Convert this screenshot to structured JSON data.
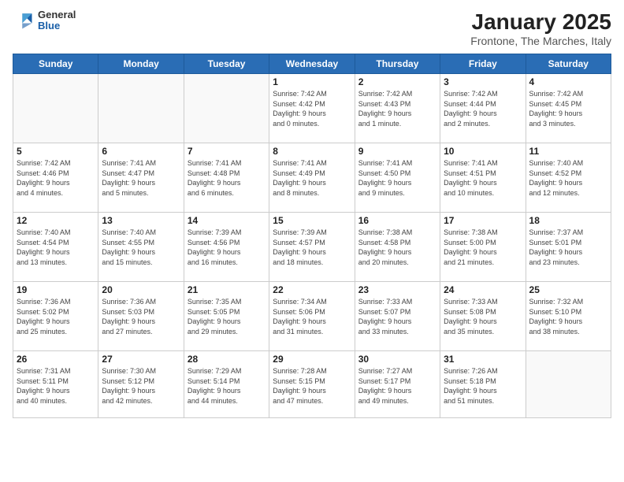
{
  "logo": {
    "line1": "General",
    "line2": "Blue"
  },
  "title": "January 2025",
  "subtitle": "Frontone, The Marches, Italy",
  "headers": [
    "Sunday",
    "Monday",
    "Tuesday",
    "Wednesday",
    "Thursday",
    "Friday",
    "Saturday"
  ],
  "weeks": [
    [
      {
        "num": "",
        "info": ""
      },
      {
        "num": "",
        "info": ""
      },
      {
        "num": "",
        "info": ""
      },
      {
        "num": "1",
        "info": "Sunrise: 7:42 AM\nSunset: 4:42 PM\nDaylight: 9 hours\nand 0 minutes."
      },
      {
        "num": "2",
        "info": "Sunrise: 7:42 AM\nSunset: 4:43 PM\nDaylight: 9 hours\nand 1 minute."
      },
      {
        "num": "3",
        "info": "Sunrise: 7:42 AM\nSunset: 4:44 PM\nDaylight: 9 hours\nand 2 minutes."
      },
      {
        "num": "4",
        "info": "Sunrise: 7:42 AM\nSunset: 4:45 PM\nDaylight: 9 hours\nand 3 minutes."
      }
    ],
    [
      {
        "num": "5",
        "info": "Sunrise: 7:42 AM\nSunset: 4:46 PM\nDaylight: 9 hours\nand 4 minutes."
      },
      {
        "num": "6",
        "info": "Sunrise: 7:41 AM\nSunset: 4:47 PM\nDaylight: 9 hours\nand 5 minutes."
      },
      {
        "num": "7",
        "info": "Sunrise: 7:41 AM\nSunset: 4:48 PM\nDaylight: 9 hours\nand 6 minutes."
      },
      {
        "num": "8",
        "info": "Sunrise: 7:41 AM\nSunset: 4:49 PM\nDaylight: 9 hours\nand 8 minutes."
      },
      {
        "num": "9",
        "info": "Sunrise: 7:41 AM\nSunset: 4:50 PM\nDaylight: 9 hours\nand 9 minutes."
      },
      {
        "num": "10",
        "info": "Sunrise: 7:41 AM\nSunset: 4:51 PM\nDaylight: 9 hours\nand 10 minutes."
      },
      {
        "num": "11",
        "info": "Sunrise: 7:40 AM\nSunset: 4:52 PM\nDaylight: 9 hours\nand 12 minutes."
      }
    ],
    [
      {
        "num": "12",
        "info": "Sunrise: 7:40 AM\nSunset: 4:54 PM\nDaylight: 9 hours\nand 13 minutes."
      },
      {
        "num": "13",
        "info": "Sunrise: 7:40 AM\nSunset: 4:55 PM\nDaylight: 9 hours\nand 15 minutes."
      },
      {
        "num": "14",
        "info": "Sunrise: 7:39 AM\nSunset: 4:56 PM\nDaylight: 9 hours\nand 16 minutes."
      },
      {
        "num": "15",
        "info": "Sunrise: 7:39 AM\nSunset: 4:57 PM\nDaylight: 9 hours\nand 18 minutes."
      },
      {
        "num": "16",
        "info": "Sunrise: 7:38 AM\nSunset: 4:58 PM\nDaylight: 9 hours\nand 20 minutes."
      },
      {
        "num": "17",
        "info": "Sunrise: 7:38 AM\nSunset: 5:00 PM\nDaylight: 9 hours\nand 21 minutes."
      },
      {
        "num": "18",
        "info": "Sunrise: 7:37 AM\nSunset: 5:01 PM\nDaylight: 9 hours\nand 23 minutes."
      }
    ],
    [
      {
        "num": "19",
        "info": "Sunrise: 7:36 AM\nSunset: 5:02 PM\nDaylight: 9 hours\nand 25 minutes."
      },
      {
        "num": "20",
        "info": "Sunrise: 7:36 AM\nSunset: 5:03 PM\nDaylight: 9 hours\nand 27 minutes."
      },
      {
        "num": "21",
        "info": "Sunrise: 7:35 AM\nSunset: 5:05 PM\nDaylight: 9 hours\nand 29 minutes."
      },
      {
        "num": "22",
        "info": "Sunrise: 7:34 AM\nSunset: 5:06 PM\nDaylight: 9 hours\nand 31 minutes."
      },
      {
        "num": "23",
        "info": "Sunrise: 7:33 AM\nSunset: 5:07 PM\nDaylight: 9 hours\nand 33 minutes."
      },
      {
        "num": "24",
        "info": "Sunrise: 7:33 AM\nSunset: 5:08 PM\nDaylight: 9 hours\nand 35 minutes."
      },
      {
        "num": "25",
        "info": "Sunrise: 7:32 AM\nSunset: 5:10 PM\nDaylight: 9 hours\nand 38 minutes."
      }
    ],
    [
      {
        "num": "26",
        "info": "Sunrise: 7:31 AM\nSunset: 5:11 PM\nDaylight: 9 hours\nand 40 minutes."
      },
      {
        "num": "27",
        "info": "Sunrise: 7:30 AM\nSunset: 5:12 PM\nDaylight: 9 hours\nand 42 minutes."
      },
      {
        "num": "28",
        "info": "Sunrise: 7:29 AM\nSunset: 5:14 PM\nDaylight: 9 hours\nand 44 minutes."
      },
      {
        "num": "29",
        "info": "Sunrise: 7:28 AM\nSunset: 5:15 PM\nDaylight: 9 hours\nand 47 minutes."
      },
      {
        "num": "30",
        "info": "Sunrise: 7:27 AM\nSunset: 5:17 PM\nDaylight: 9 hours\nand 49 minutes."
      },
      {
        "num": "31",
        "info": "Sunrise: 7:26 AM\nSunset: 5:18 PM\nDaylight: 9 hours\nand 51 minutes."
      },
      {
        "num": "",
        "info": ""
      }
    ]
  ]
}
